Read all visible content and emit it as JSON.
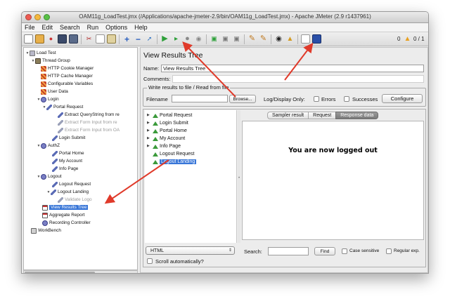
{
  "window": {
    "title": "OAM11g_LoadTest.jmx (/Applications/apache-jmeter-2.9/bin/OAM11g_LoadTest.jmx) - Apache JMeter (2.9 r1437961)"
  },
  "menu": [
    "File",
    "Edit",
    "Search",
    "Run",
    "Options",
    "Help"
  ],
  "toolbar": {
    "icons": [
      "new-icon",
      "templates-icon",
      "open-icon",
      "save-icon",
      "save-as-icon",
      "cut-icon",
      "copy-icon",
      "paste-icon",
      "expand-icon",
      "collapse-icon",
      "toggle-icon",
      "start-icon",
      "start-no-pause-icon",
      "stop-icon",
      "shutdown-icon",
      "remote-start-icon",
      "remote-stop-icon",
      "remote-shutdown-icon",
      "clear-icon",
      "clear-all-icon",
      "search-icon",
      "reset-search-icon",
      "function-helper-icon",
      "help-icon"
    ],
    "warning_count": "0",
    "thread_count": "0 / 1"
  },
  "tree": {
    "items": [
      {
        "label": "Load Test",
        "level": 0,
        "icon": "flask-icon",
        "expanded": true
      },
      {
        "label": "Thread Group",
        "level": 1,
        "icon": "thread-group-icon",
        "expanded": true
      },
      {
        "label": "HTTP Cookie Manager",
        "level": 2,
        "icon": "config-icon"
      },
      {
        "label": "HTTP Cache Manager",
        "level": 2,
        "icon": "config-icon"
      },
      {
        "label": "Configurable Variables",
        "level": 2,
        "icon": "config-icon"
      },
      {
        "label": "User Data",
        "level": 2,
        "icon": "config-icon"
      },
      {
        "label": "Login",
        "level": 2,
        "icon": "controller-icon",
        "expanded": true
      },
      {
        "label": "Portal Request",
        "level": 3,
        "icon": "sampler-icon",
        "expanded": true
      },
      {
        "label": "Extract QueryString from re",
        "level": 4,
        "icon": "extractor-icon"
      },
      {
        "label": "Extract Form Input from re",
        "level": 4,
        "icon": "extractor-icon",
        "disabled": true
      },
      {
        "label": "Extract Form Input from OA",
        "level": 4,
        "icon": "extractor-icon",
        "disabled": true
      },
      {
        "label": "Login Submit",
        "level": 3,
        "icon": "sampler-icon"
      },
      {
        "label": "AuthZ",
        "level": 2,
        "icon": "controller-icon",
        "expanded": true
      },
      {
        "label": "Portal Home",
        "level": 3,
        "icon": "sampler-icon"
      },
      {
        "label": "My Account",
        "level": 3,
        "icon": "sampler-icon"
      },
      {
        "label": "Info Page",
        "level": 3,
        "icon": "sampler-icon"
      },
      {
        "label": "Logout",
        "level": 2,
        "icon": "controller-icon",
        "expanded": true
      },
      {
        "label": "Logout Request",
        "level": 3,
        "icon": "sampler-icon"
      },
      {
        "label": "Logout Landing",
        "level": 3,
        "icon": "sampler-icon",
        "expanded": true
      },
      {
        "label": "Validate Logo",
        "level": 4,
        "icon": "assertion-icon",
        "disabled": true
      },
      {
        "label": "View Results Tree",
        "level": 2,
        "icon": "listener-icon",
        "selected": true
      },
      {
        "label": "Aggregate Report",
        "level": 2,
        "icon": "listener-icon"
      },
      {
        "label": "Recording Controller",
        "level": 2,
        "icon": "controller-icon"
      },
      {
        "label": "WorkBench",
        "level": 0,
        "icon": "workbench-icon"
      }
    ]
  },
  "panel": {
    "title": "View Results Tree",
    "name_label": "Name:",
    "name_value": "View Results Tree",
    "comments_label": "Comments:",
    "comments_value": "",
    "file_section_title": "Write results to file / Read from file",
    "filename_label": "Filename",
    "browse_label": "Browse...",
    "log_display_label": "Log/Display Only:",
    "errors_label": "Errors",
    "successes_label": "Successes",
    "configure_label": "Configure"
  },
  "results": {
    "items": [
      "Portal Request",
      "Login Submit",
      "Portal Home",
      "My Account",
      "Info Page",
      "Logout Request",
      "Logout Landing"
    ],
    "selected": "Logout Landing",
    "tabs": [
      "Sampler result",
      "Request",
      "Response data"
    ],
    "active_tab": "Response data",
    "response_text": "You are now logged out",
    "renderer": "HTML",
    "scroll_auto_label": "Scroll automatically?",
    "search_label": "Search:",
    "find_label": "Find",
    "case_sensitive_label": "Case sensitive",
    "regular_exp_label": "Regular exp."
  },
  "colors": {
    "selection": "#3876d8",
    "annotation_arrow": "#e03a2a",
    "close_light": "#ee5b52",
    "minimize_light": "#f5b83d",
    "zoom_light": "#58c145"
  }
}
